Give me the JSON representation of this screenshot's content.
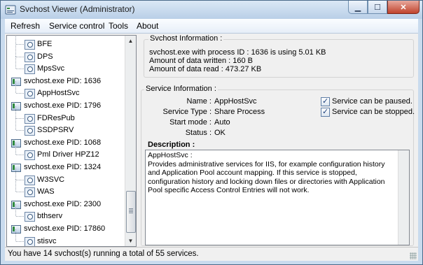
{
  "window": {
    "title": "Svchost Viewer (Administrator)",
    "controls": {
      "minimize": "▁",
      "maximize": "☐",
      "close": "✕"
    }
  },
  "menu": {
    "items": [
      "Refresh",
      "Service control",
      "Tools",
      "About"
    ]
  },
  "tree": {
    "nodes": [
      {
        "type": "service",
        "label": "BFE"
      },
      {
        "type": "service",
        "label": "DPS"
      },
      {
        "type": "service",
        "label": "MpsSvc"
      },
      {
        "type": "process",
        "label": "svchost.exe PID: 1636"
      },
      {
        "type": "service",
        "label": "AppHostSvc"
      },
      {
        "type": "process",
        "label": "svchost.exe PID: 1796"
      },
      {
        "type": "service",
        "label": "FDResPub"
      },
      {
        "type": "service",
        "label": "SSDPSRV"
      },
      {
        "type": "process",
        "label": "svchost.exe PID: 1068"
      },
      {
        "type": "service",
        "label": "Pml Driver HPZ12"
      },
      {
        "type": "process",
        "label": "svchost.exe PID: 1324"
      },
      {
        "type": "service",
        "label": "W3SVC"
      },
      {
        "type": "service",
        "label": "WAS"
      },
      {
        "type": "process",
        "label": "svchost.exe PID: 2300"
      },
      {
        "type": "service",
        "label": "bthserv"
      },
      {
        "type": "process",
        "label": "svchost.exe PID: 17860"
      },
      {
        "type": "service",
        "label": "stisvc"
      }
    ]
  },
  "svchost_info": {
    "title": "Svchost Information :",
    "line1": "svchost.exe with process ID : 1636 is using 5.01 KB",
    "line2": "Amount of data written : 160 B",
    "line3": "Amount of data read : 473.27 KB"
  },
  "service_info": {
    "title": "Service Information :",
    "name_label": "Name :",
    "name_value": "AppHostSvc",
    "type_label": "Service Type :",
    "type_value": "Share Process",
    "start_label": "Start mode :",
    "start_value": "Auto",
    "status_label": "Status :",
    "status_value": "OK",
    "can_pause_label": "Service can be paused.",
    "can_stop_label": "Service can be stopped."
  },
  "description": {
    "label": "Description :",
    "text_heading": "AppHostSvc :",
    "text_body": "Provides administrative services for IIS, for example configuration history and Application Pool account mapping. If this service is stopped, configuration history and locking down files or directories with Application Pool specific Access Control Entries will not work."
  },
  "status_bar": {
    "text": "You have 14 svchost(s) running a total of 55 services."
  },
  "colors": {
    "title_bar": "#c9dbee",
    "close_button": "#c0432c",
    "panel": "#f0f0f0",
    "process_icon_accent": "#2f8a3e"
  }
}
